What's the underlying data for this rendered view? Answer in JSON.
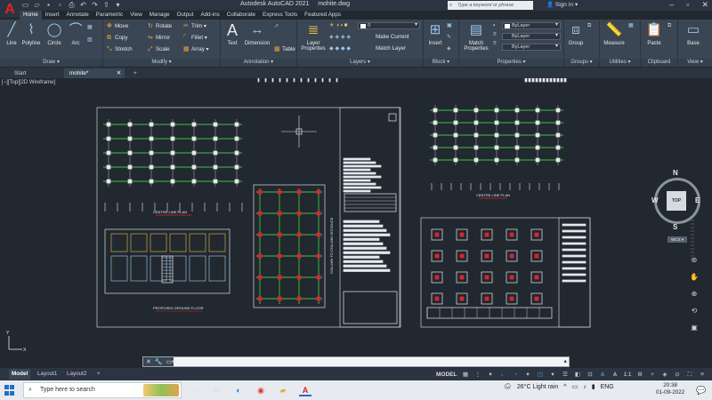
{
  "titlebar": {
    "app_name": "Autodesk AutoCAD 2021",
    "file_name": "mohite.dwg",
    "search_placeholder": "Type a keyword or phrase",
    "sign_in": "Sign In"
  },
  "ribbon_tabs": [
    "Home",
    "Insert",
    "Annotate",
    "Parametric",
    "View",
    "Manage",
    "Output",
    "Add-ins",
    "Collaborate",
    "Express Tools",
    "Featured Apps"
  ],
  "ribbon": {
    "draw": {
      "title": "Draw",
      "line": "Line",
      "polyline": "Polyline",
      "circle": "Circle",
      "arc": "Arc"
    },
    "modify": {
      "title": "Modify",
      "move": "Move",
      "rotate": "Rotate",
      "trim": "Trim",
      "copy": "Copy",
      "mirror": "Mirror",
      "fillet": "Fillet",
      "stretch": "Stretch",
      "scale": "Scale",
      "array": "Array"
    },
    "annotation": {
      "title": "Annotation",
      "text": "Text",
      "dimension": "Dimension",
      "table": "Table"
    },
    "layers": {
      "title": "Layers",
      "layer_properties": "Layer Properties",
      "make_current": "Make Current",
      "match_layer": "Match Layer",
      "current_layer": "0"
    },
    "block": {
      "title": "Block",
      "insert": "Insert"
    },
    "properties": {
      "title": "Properties",
      "match_properties": "Match Properties",
      "color": "ByLayer",
      "linetype": "ByLayer",
      "lineweight": "ByLayer"
    },
    "groups": {
      "title": "Groups",
      "group": "Group"
    },
    "utilities": {
      "title": "Utilities",
      "measure": "Measure"
    },
    "clipboard": {
      "title": "Clipboard",
      "paste": "Paste"
    },
    "view": {
      "title": "View",
      "base": "Base"
    }
  },
  "file_tabs": {
    "start": "Start",
    "current": "mohite*",
    "add": "+"
  },
  "viewport_label": "[−][Top][2D Wireframe]",
  "drawing_labels": {
    "centre_line_plan_1": "CENTRE LINE PLAN",
    "proposed_ground_floor": "PROPOSED GROUND FLOOR",
    "centre_line_plan_2": "CENTRE LINE PLAN",
    "column_layout": "COLUMN TO COLUMN DISTANCE",
    "schedule_title": "SCHEDULE OF COLUMNS"
  },
  "viewcube": {
    "top": "TOP",
    "n": "N",
    "s": "S",
    "e": "E",
    "w": "W",
    "wcs": "WCS"
  },
  "command_line": {
    "placeholder": ""
  },
  "model_tabs": {
    "model": "Model",
    "layout1": "Layout1",
    "layout2": "Layout2",
    "add": "+"
  },
  "statusbar": {
    "model": "MODEL",
    "scale": "1:1"
  },
  "taskbar": {
    "search_placeholder": "Type here to search",
    "weather": "26°C  Light rain",
    "lang": "ENG",
    "time": "20:38",
    "date": "01-09-2022"
  },
  "colors": {
    "accent": "#49a3e6",
    "autocad_red": "#e0232b",
    "canvas": "#212830",
    "ribbon": "#3a4654"
  }
}
